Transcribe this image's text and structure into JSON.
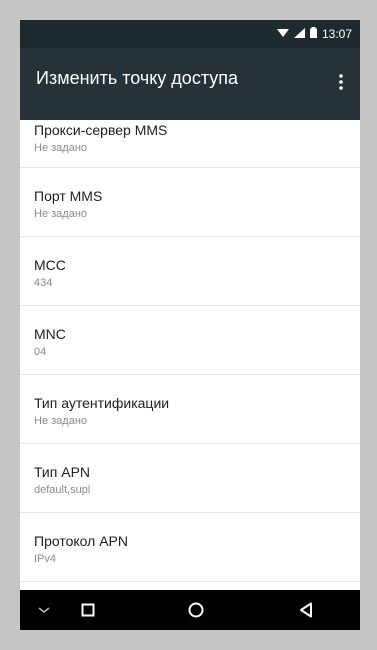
{
  "status": {
    "time": "13:07"
  },
  "toolbar": {
    "title": "Изменить точку доступа"
  },
  "items": [
    {
      "title": "Прокси-сервер MMS",
      "value": "Не задано"
    },
    {
      "title": "Порт MMS",
      "value": "Не задано"
    },
    {
      "title": "MCC",
      "value": "434"
    },
    {
      "title": "MNC",
      "value": "04"
    },
    {
      "title": "Тип аутентификации",
      "value": "Не задано"
    },
    {
      "title": "Тип APN",
      "value": "default,supl"
    },
    {
      "title": "Протокол APN",
      "value": "IPv4"
    }
  ],
  "colors": {
    "toolbar": "#263238",
    "statusbar": "#1f2a2f",
    "navbar": "#000000",
    "title_text": "#212121",
    "secondary_text": "#8a8a8a"
  },
  "icons": [
    "wifi-icon",
    "signal-icon",
    "battery-icon",
    "more-vert-icon",
    "hide-keyboard-icon",
    "recent-apps-icon",
    "home-icon",
    "back-icon"
  ]
}
